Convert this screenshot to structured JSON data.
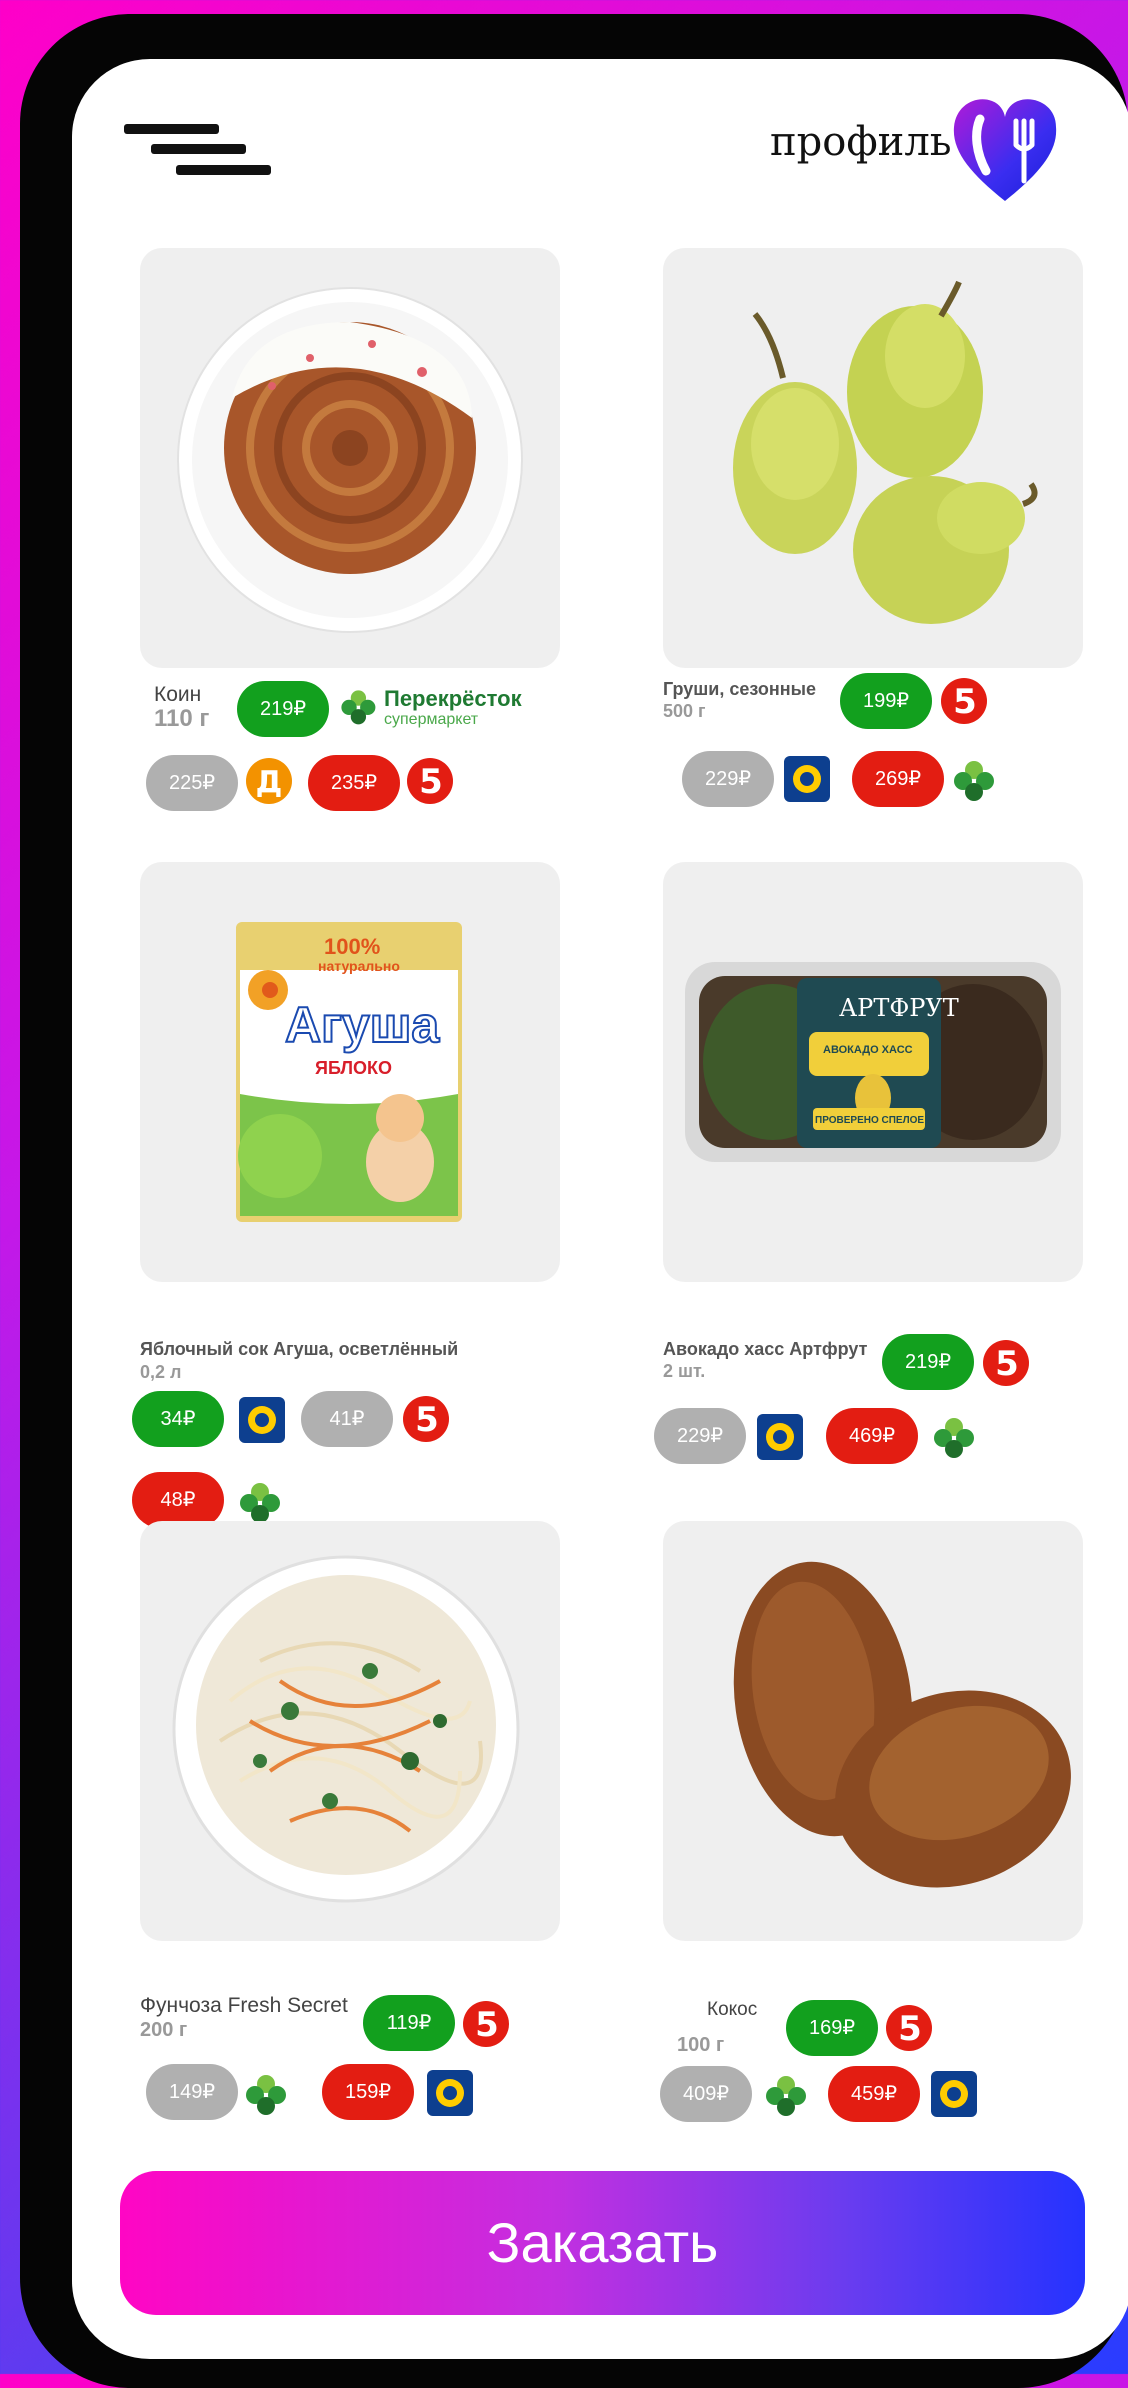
{
  "header": {
    "menu_icon": "hamburger-menu-icon",
    "profile_label": "профиль",
    "logo_icon": "heart-fork-knife-logo"
  },
  "products": [
    {
      "name": "Коин",
      "weight": "110 г",
      "offers": [
        {
          "price": "219₽",
          "status": "best",
          "store": "Перекрёсток",
          "store_sub": "супермаркет"
        },
        {
          "price": "225₽",
          "status": "other",
          "store": "Дикси"
        },
        {
          "price": "235₽",
          "status": "worst",
          "store": "Пятёрочка"
        }
      ]
    },
    {
      "name": "Груши, сезонные",
      "weight": "500 г",
      "offers": [
        {
          "price": "199₽",
          "status": "best",
          "store": "Пятёрочка"
        },
        {
          "price": "229₽",
          "status": "other",
          "store": "Лента"
        },
        {
          "price": "269₽",
          "status": "worst",
          "store": "Перекрёсток"
        }
      ]
    },
    {
      "name": "Яблочный сок Агуша, осветлённый",
      "weight": "0,2 л",
      "offers": [
        {
          "price": "34₽",
          "status": "best",
          "store": "Лента"
        },
        {
          "price": "41₽",
          "status": "other",
          "store": "Пятёрочка"
        },
        {
          "price": "48₽",
          "status": "worst",
          "store": "Перекрёсток"
        }
      ],
      "image_text": {
        "badge": "100%",
        "badge_sub": "натурально",
        "brand": "Агуша",
        "flavor": "ЯБЛОКО"
      }
    },
    {
      "name": "Авокадо хасс Артфрут",
      "weight": "2 шт.",
      "offers": [
        {
          "price": "219₽",
          "status": "best",
          "store": "Пятёрочка"
        },
        {
          "price": "229₽",
          "status": "other",
          "store": "Лента"
        },
        {
          "price": "469₽",
          "status": "worst",
          "store": "Перекрёсток"
        }
      ],
      "image_text": {
        "brand": "АРТФРУТ",
        "label": "АВОКАДО ХАСС",
        "sticker": "ПРОВЕРЕНО СПЕЛОЕ"
      }
    },
    {
      "name": "Фунчоза Fresh Secret",
      "weight": "200 г",
      "offers": [
        {
          "price": "119₽",
          "status": "best",
          "store": "Пятёрочка"
        },
        {
          "price": "149₽",
          "status": "other",
          "store": "Перекрёсток"
        },
        {
          "price": "159₽",
          "status": "worst",
          "store": "Лента"
        }
      ]
    },
    {
      "name": "Кокос",
      "weight": "100 г",
      "offers": [
        {
          "price": "169₽",
          "status": "best",
          "store": "Пятёрочка"
        },
        {
          "price": "409₽",
          "status": "other",
          "store": "Перекрёсток"
        },
        {
          "price": "459₽",
          "status": "worst",
          "store": "Лента"
        }
      ]
    }
  ],
  "order_button": {
    "label": "Заказать"
  },
  "colors": {
    "best_price": "#12a01e",
    "other_price": "#b0b0b0",
    "worst_price": "#e31d12",
    "order_gradient_start": "#ff06c4",
    "order_gradient_end": "#2533ff"
  }
}
